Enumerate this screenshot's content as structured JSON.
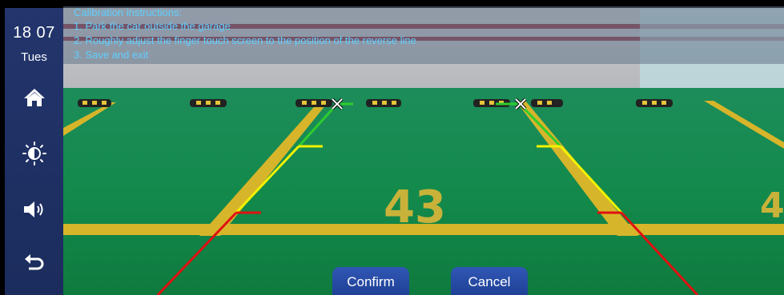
{
  "status": {
    "time": "18 07",
    "day": "Tues"
  },
  "sidebar": {
    "items": [
      {
        "icon": "home-icon"
      },
      {
        "icon": "brightness-icon"
      },
      {
        "icon": "volume-icon"
      },
      {
        "icon": "back-icon"
      }
    ]
  },
  "instructions": {
    "title": "Calibration instructions:",
    "steps": [
      "1. Park the car outside the garage",
      "2. Roughly adjust the finger touch screen to the position of the reverse line",
      "3. Save and exit"
    ]
  },
  "scene": {
    "bay_number": "43"
  },
  "colors": {
    "sidebar": "#1b2c5d",
    "instruction_text": "#5fd0ff",
    "guide_green": "#2ecc2e",
    "guide_yellow": "#f2f200",
    "guide_red": "#e01010",
    "floor": "#138a4c",
    "button": "#2a4ea8"
  },
  "actions": {
    "confirm": "Confirm",
    "cancel": "Cancel"
  }
}
